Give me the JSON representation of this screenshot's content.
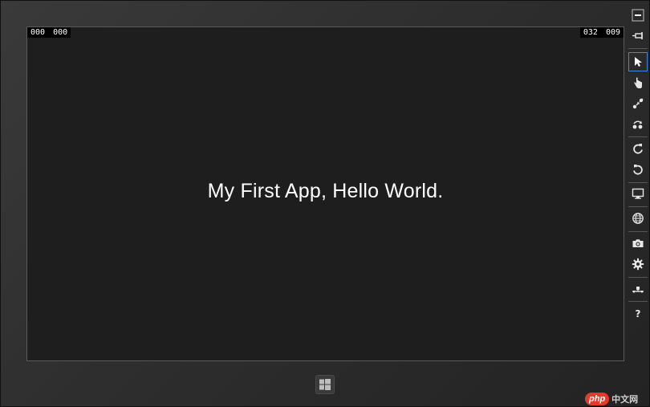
{
  "emulator": {
    "counters_left": [
      "000",
      "000"
    ],
    "counters_right": [
      "032",
      "009"
    ],
    "app_text": "My First App, Hello World."
  },
  "toolbar": {
    "tools": [
      {
        "name": "minimize",
        "icon": "minimize-icon"
      },
      {
        "name": "always-on-top",
        "icon": "pin-icon"
      },
      {
        "name": "mouse-mode",
        "icon": "cursor-arrow-icon",
        "active": true
      },
      {
        "name": "basic-touch-mode",
        "icon": "hand-pointer-icon"
      },
      {
        "name": "pinch-zoom-touch-mode",
        "icon": "pinch-zoom-icon"
      },
      {
        "name": "rotation-touch-mode",
        "icon": "rotation-touch-icon"
      },
      {
        "name": "rotate-clockwise",
        "icon": "rotate-clockwise-icon"
      },
      {
        "name": "rotate-counterclockwise",
        "icon": "rotate-counterclockwise-icon"
      },
      {
        "name": "change-resolution",
        "icon": "monitor-icon"
      },
      {
        "name": "set-location",
        "icon": "globe-icon"
      },
      {
        "name": "copy-screenshot",
        "icon": "camera-icon"
      },
      {
        "name": "screenshot-settings",
        "icon": "gear-icon"
      },
      {
        "name": "change-network-properties",
        "icon": "network-icon"
      },
      {
        "name": "help",
        "icon": "help-icon",
        "label": "?"
      }
    ]
  },
  "watermark": {
    "logo": "php",
    "text": "中文网"
  },
  "colors": {
    "frame": "#2d2d2d",
    "screen": "#1e1e1e",
    "active_tool_border": "#3c8ad9",
    "watermark_red": "#e23a2b"
  }
}
